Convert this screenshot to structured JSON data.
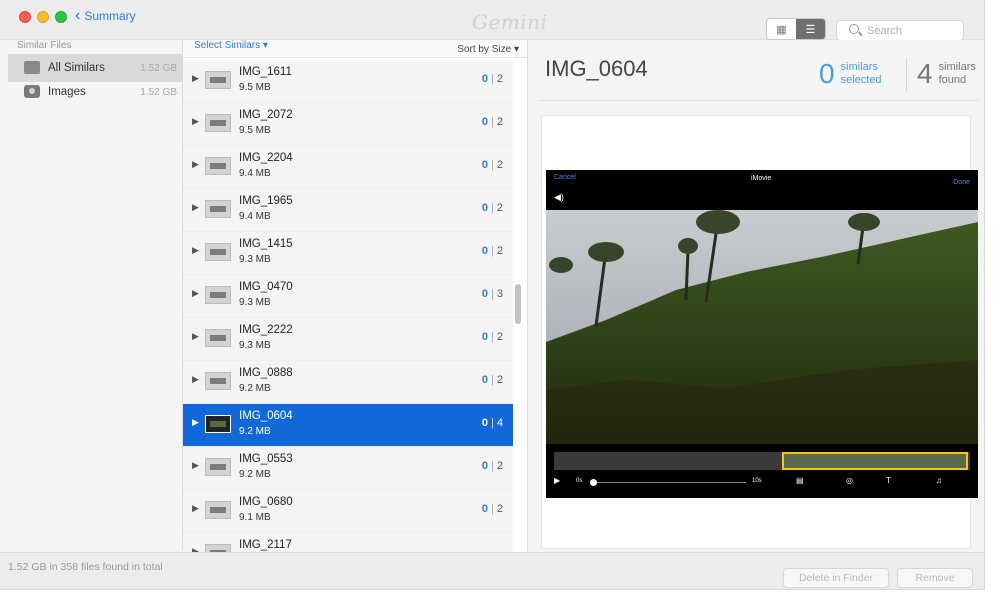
{
  "titlebar": {
    "back_label": "Summary",
    "logo_text": "Gemini",
    "search_placeholder": "Search"
  },
  "sidebar": {
    "header": "Similar Files",
    "items": [
      {
        "label": "All Similars",
        "size": "1.52 GB",
        "icon": "disk-icon",
        "selected": true
      },
      {
        "label": "Images",
        "size": "1.52 GB",
        "icon": "camera-icon",
        "selected": false
      }
    ]
  },
  "list": {
    "select_similars": "Select Similars ▾",
    "sort_by": "Sort by Size ▾",
    "rows": [
      {
        "name": "IMG_1611",
        "size": "9.5 MB",
        "selected": "0",
        "total": "2"
      },
      {
        "name": "IMG_2072",
        "size": "9.5 MB",
        "selected": "0",
        "total": "2"
      },
      {
        "name": "IMG_2204",
        "size": "9.4 MB",
        "selected": "0",
        "total": "2"
      },
      {
        "name": "IMG_1965",
        "size": "9.4 MB",
        "selected": "0",
        "total": "2"
      },
      {
        "name": "IMG_1415",
        "size": "9.3 MB",
        "selected": "0",
        "total": "2"
      },
      {
        "name": "IMG_0470",
        "size": "9.3 MB",
        "selected": "0",
        "total": "3"
      },
      {
        "name": "IMG_2222",
        "size": "9.3 MB",
        "selected": "0",
        "total": "2"
      },
      {
        "name": "IMG_0888",
        "size": "9.2 MB",
        "selected": "0",
        "total": "2"
      },
      {
        "name": "IMG_0604",
        "size": "9.2 MB",
        "selected": "0",
        "total": "4"
      },
      {
        "name": "IMG_0553",
        "size": "9.2 MB",
        "selected": "0",
        "total": "2"
      },
      {
        "name": "IMG_0680",
        "size": "9.1 MB",
        "selected": "0",
        "total": "2"
      },
      {
        "name": "IMG_2117",
        "size": "",
        "selected": "",
        "total": ""
      }
    ],
    "selected_index": 8
  },
  "detail": {
    "title": "IMG_0604",
    "similars_selected_count": "0",
    "similars_selected_label_1": "similars",
    "similars_selected_label_2": "selected",
    "similars_found_count": "4",
    "similars_found_label_1": "similars",
    "similars_found_label_2": "found"
  },
  "preview": {
    "cancel": "Cancel",
    "title": "iMovie",
    "done": "Done",
    "time_start": "0s",
    "time_end": "10s"
  },
  "status": {
    "text": "1.52 GB in 358 files found in total",
    "delete_button": "Delete in Finder",
    "remove_button": "Remove"
  },
  "colors": {
    "accent": "#2f7bd8",
    "selection": "#1169d9"
  }
}
